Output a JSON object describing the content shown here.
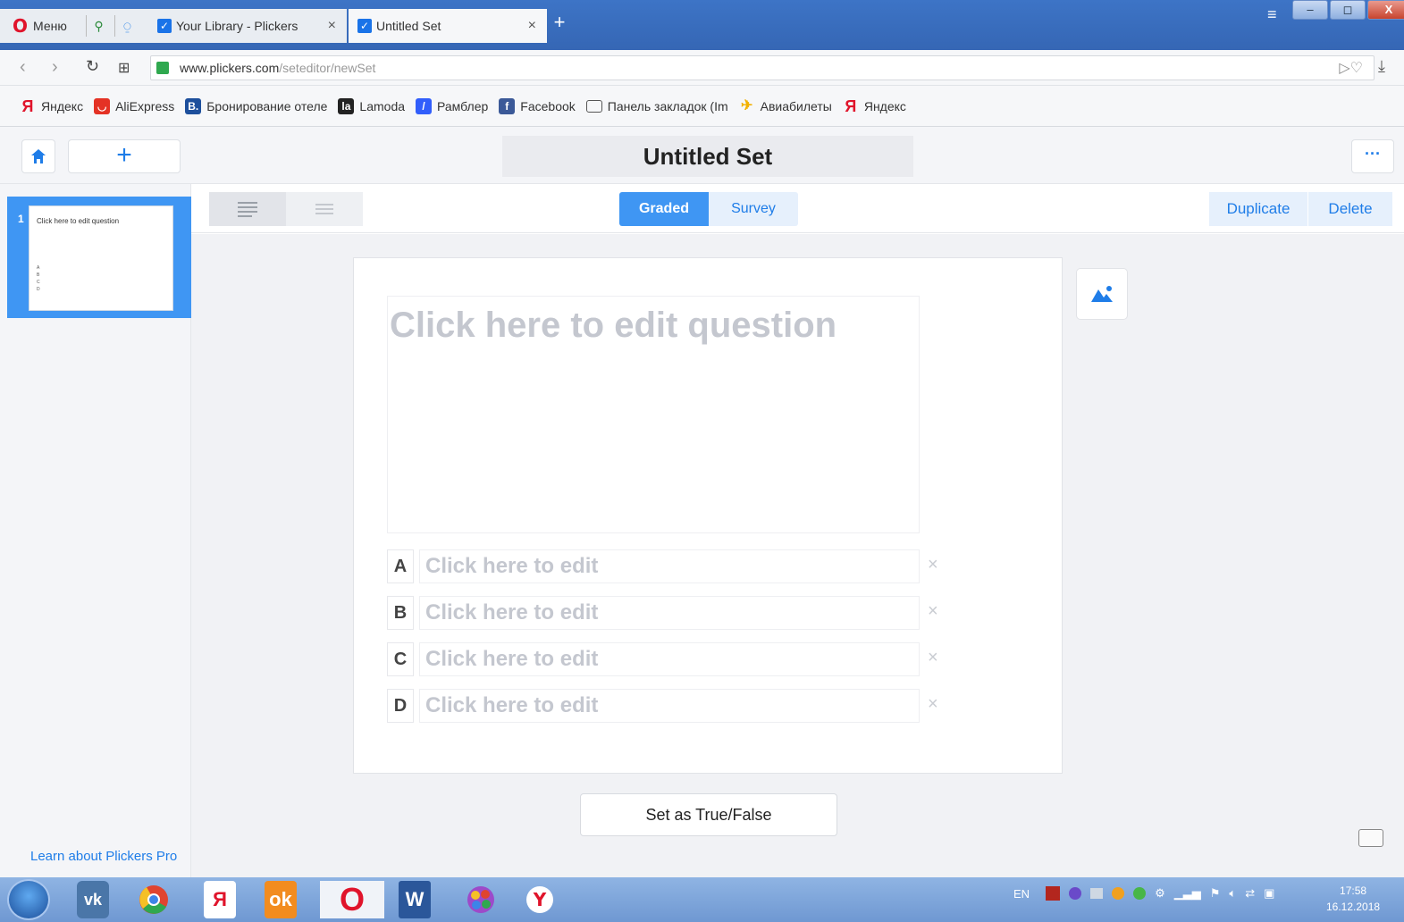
{
  "browser": {
    "menu_label": "Меню",
    "tabs": [
      {
        "title": "Your Library - Plickers",
        "close": "×"
      },
      {
        "title": "Untitled Set",
        "close": "×"
      }
    ],
    "new_tab": "+",
    "url_host": "www.plickers.com",
    "url_path": "/seteditor/newSet",
    "bookmarks": [
      {
        "label": "Яндекс",
        "icon": "Я",
        "color": "#e0142b"
      },
      {
        "label": "AliExpress",
        "icon": "◡",
        "color": "#e43225"
      },
      {
        "label": "Бронирование отеле",
        "icon": "B.",
        "color": "#1d4f9c"
      },
      {
        "label": "Lamoda",
        "icon": "la",
        "color": "#222222"
      },
      {
        "label": "Рамблер",
        "icon": "/",
        "color": "#315efb"
      },
      {
        "label": "Facebook",
        "icon": "f",
        "color": "#3b5998"
      },
      {
        "label": "Панель закладок (Im",
        "icon": "▭",
        "color": "#ffffff"
      },
      {
        "label": "Авиабилеты",
        "icon": "✈",
        "color": "#f2b100"
      },
      {
        "label": "Яндекс",
        "icon": "Я",
        "color": "#e0142b"
      }
    ]
  },
  "header": {
    "title": "Untitled Set",
    "add_label": "+",
    "more_label": "···"
  },
  "sidebar": {
    "slides": [
      {
        "number": "1",
        "question": "Click here to edit question",
        "choices": [
          "A",
          "B",
          "C",
          "D"
        ]
      }
    ],
    "learn_link": "Learn about Plickers Pro"
  },
  "toolbar": {
    "modes": {
      "graded": "Graded",
      "survey": "Survey"
    },
    "duplicate": "Duplicate",
    "delete": "Delete"
  },
  "editor": {
    "question_placeholder": "Click here to edit question",
    "choices": [
      {
        "letter": "A",
        "placeholder": "Click here to edit"
      },
      {
        "letter": "B",
        "placeholder": "Click here to edit"
      },
      {
        "letter": "C",
        "placeholder": "Click here to edit"
      },
      {
        "letter": "D",
        "placeholder": "Click here to edit"
      }
    ],
    "remove_symbol": "×",
    "true_false_button": "Set as True/False"
  },
  "taskbar": {
    "lang": "EN",
    "time": "17:58",
    "date": "16.12.2018"
  },
  "colors": {
    "accent": "#3f96f3",
    "link": "#1f7de8",
    "placeholder": "#c4c7cf"
  }
}
